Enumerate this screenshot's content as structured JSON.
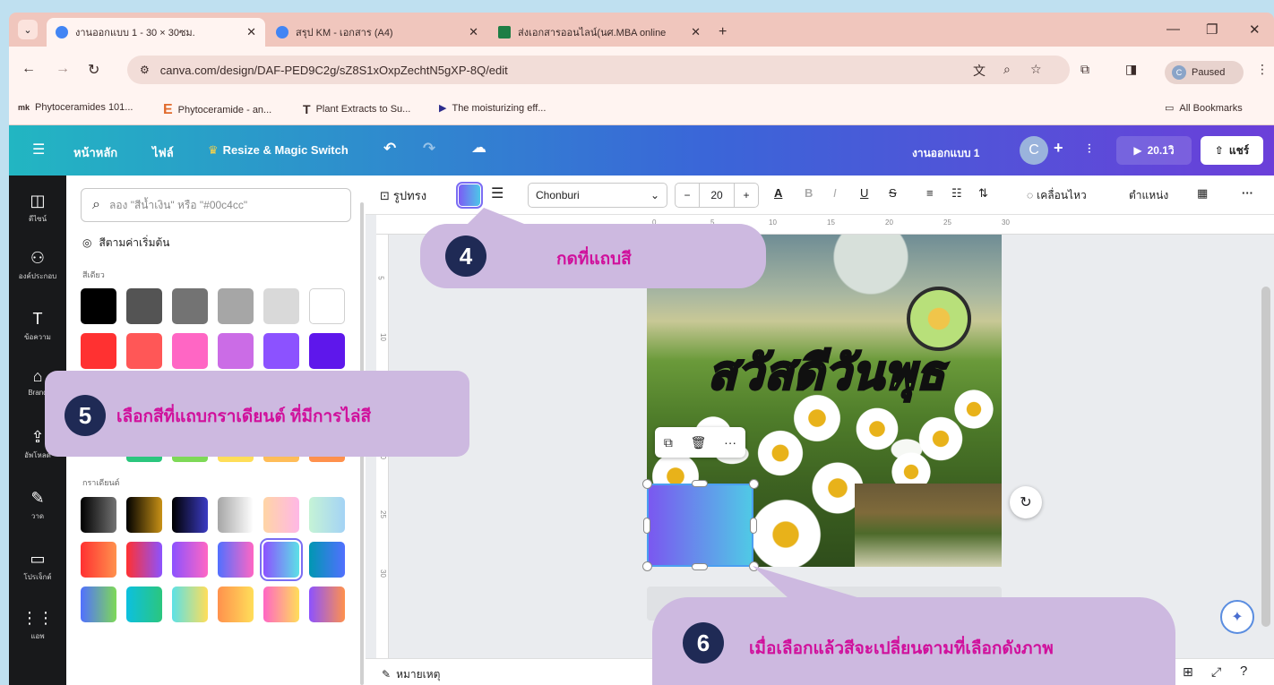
{
  "browser": {
    "tabs": [
      {
        "title": "งานออกแบบ 1 - 30 × 30ซม.",
        "favicon_color": "#4285f4"
      },
      {
        "title": "สรุป KM - เอกสาร (A4)",
        "favicon_color": "#4285f4"
      },
      {
        "title": "ส่งเอกสารออนไลน์(นศ.MBA online",
        "favicon_color": "#1e7e45"
      }
    ],
    "new_tab": "+",
    "url": "canva.com/design/DAF-PED9C2g/sZ8S1xOxpZechtN5gXP-8Q/edit",
    "profile_initial": "C",
    "profile_status": "Paused",
    "bookmarks": [
      {
        "icon": "mk",
        "label": "Phytoceramides 101..."
      },
      {
        "icon": "E",
        "label": "Phytoceramide - an..."
      },
      {
        "icon": "T",
        "label": "Plant Extracts to Su..."
      },
      {
        "icon": "▶",
        "label": "The moisturizing eff..."
      }
    ],
    "all_bookmarks": "All Bookmarks"
  },
  "canva": {
    "menu": {
      "home": "หน้าหลัก",
      "file": "ไฟล์",
      "resize": "Resize & Magic Switch"
    },
    "design_title": "งานออกแบบ 1",
    "avatar_initial": "C",
    "present_time": "20.1วิ",
    "share": "แชร์",
    "sidebar": [
      {
        "icon": "◫",
        "label": "ดีไซน์"
      },
      {
        "icon": "⚇",
        "label": "องค์ประกอบ"
      },
      {
        "icon": "T",
        "label": "ข้อความ"
      },
      {
        "icon": "⌂",
        "label": "Brand"
      },
      {
        "icon": "⇪",
        "label": "อัพโหลด"
      },
      {
        "icon": "✎",
        "label": "วาด"
      },
      {
        "icon": "▭",
        "label": "โปรเจ็กต์"
      },
      {
        "icon": "⋮⋮",
        "label": "แอพ"
      }
    ],
    "color_panel": {
      "search_placeholder": "ลอง \"สีน้ำเงิน\" หรือ \"#00c4cc\"",
      "section_title": "สีตามค่าเริ่มต้น",
      "solid_label": "สีเดียว",
      "gradient_label": "กราเดียนต์",
      "solid_colors": [
        "#000000",
        "#545454",
        "#737373",
        "#a6a6a6",
        "#d9d9d9",
        "#ffffff",
        "#ff3131",
        "#ff5757",
        "#ff66c4",
        "#cb6ce6",
        "#8c52ff",
        "#5e17eb"
      ],
      "partial_row": [
        "#2bc67e",
        "#7ed957",
        "#ffde59",
        "#ffbd59",
        "#ff914d"
      ],
      "gradients": [
        "linear-gradient(90deg,#000000,#737373)",
        "linear-gradient(90deg,#000000,#c89116)",
        "linear-gradient(90deg,#000000,#3b3bc4)",
        "linear-gradient(90deg,#a6a6a6,#ffffff)",
        "linear-gradient(90deg,#ffd5a5,#ffb7e6)",
        "linear-gradient(90deg,#c5f3d6,#a4d3f5)",
        "linear-gradient(90deg,#ff3131,#ff914d)",
        "linear-gradient(90deg,#ff3131,#8c52ff)",
        "linear-gradient(90deg,#8c52ff,#ff66c4)",
        "linear-gradient(90deg,#5170ff,#ff66c4)",
        "linear-gradient(90deg,#8c52ff,#5ce1e6)",
        "linear-gradient(90deg,#0097b2,#5170ff)",
        "linear-gradient(90deg,#5170ff,#7ed957)",
        "linear-gradient(90deg,#0cc0df,#2bc67e)",
        "linear-gradient(90deg,#5ce1e6,#ffde59)",
        "linear-gradient(90deg,#ff914d,#ffde59)",
        "linear-gradient(90deg,#ff66c4,#ffde59)",
        "linear-gradient(90deg,#8c52ff,#ff914d)"
      ],
      "selected_gradient_index": 10
    },
    "toolbar": {
      "shape": "รูปทรง",
      "font": "Chonburi",
      "font_size": "20",
      "minus": "−",
      "plus": "+",
      "bold": "B",
      "italic": "I",
      "underline": "U",
      "strike": "S",
      "animate": "เคลื่อนไหว",
      "position": "ตำแหน่ง",
      "more": "···"
    },
    "ruler_h": [
      "0",
      "5",
      "10",
      "15",
      "20",
      "25",
      "30"
    ],
    "ruler_v": [
      "5",
      "10",
      "15",
      "20",
      "25",
      "30"
    ],
    "design_headline": "สวัสดีวันพุธ",
    "notes": "หมายเหตุ"
  },
  "callouts": [
    {
      "number": "4",
      "text": "กดที่แถบสี"
    },
    {
      "number": "5",
      "text": "เลือกสีที่แถบกราเดียนต์ ที่มีการไล่สี"
    },
    {
      "number": "6",
      "text": "เมื่อเลือกแล้วสีจะเปลี่ยนตามที่เลือกดังภาพ"
    }
  ],
  "colors": {
    "callout_bg": "#cdb9e0",
    "callout_text": "#d0109c",
    "badge": "#1f2a55"
  }
}
